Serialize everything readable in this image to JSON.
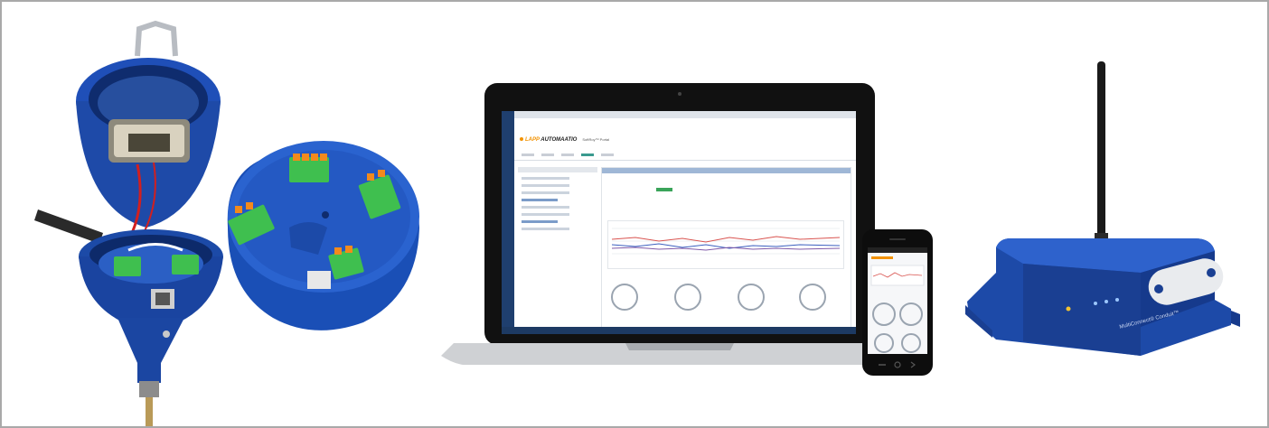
{
  "scene": {
    "background": "#ffffff",
    "border_color": "#a9a9a9",
    "product_blue": "#1f4fb8",
    "terminal_green": "#3fbf4f",
    "terminal_orange": "#f28a1c"
  },
  "laptop": {
    "brand": "LAPP",
    "brand_suffix": "AUTOMAATIO",
    "app_name": "SoftRoy™ Portal"
  },
  "gateway": {
    "label": "MultiConnect® Conduit™"
  }
}
